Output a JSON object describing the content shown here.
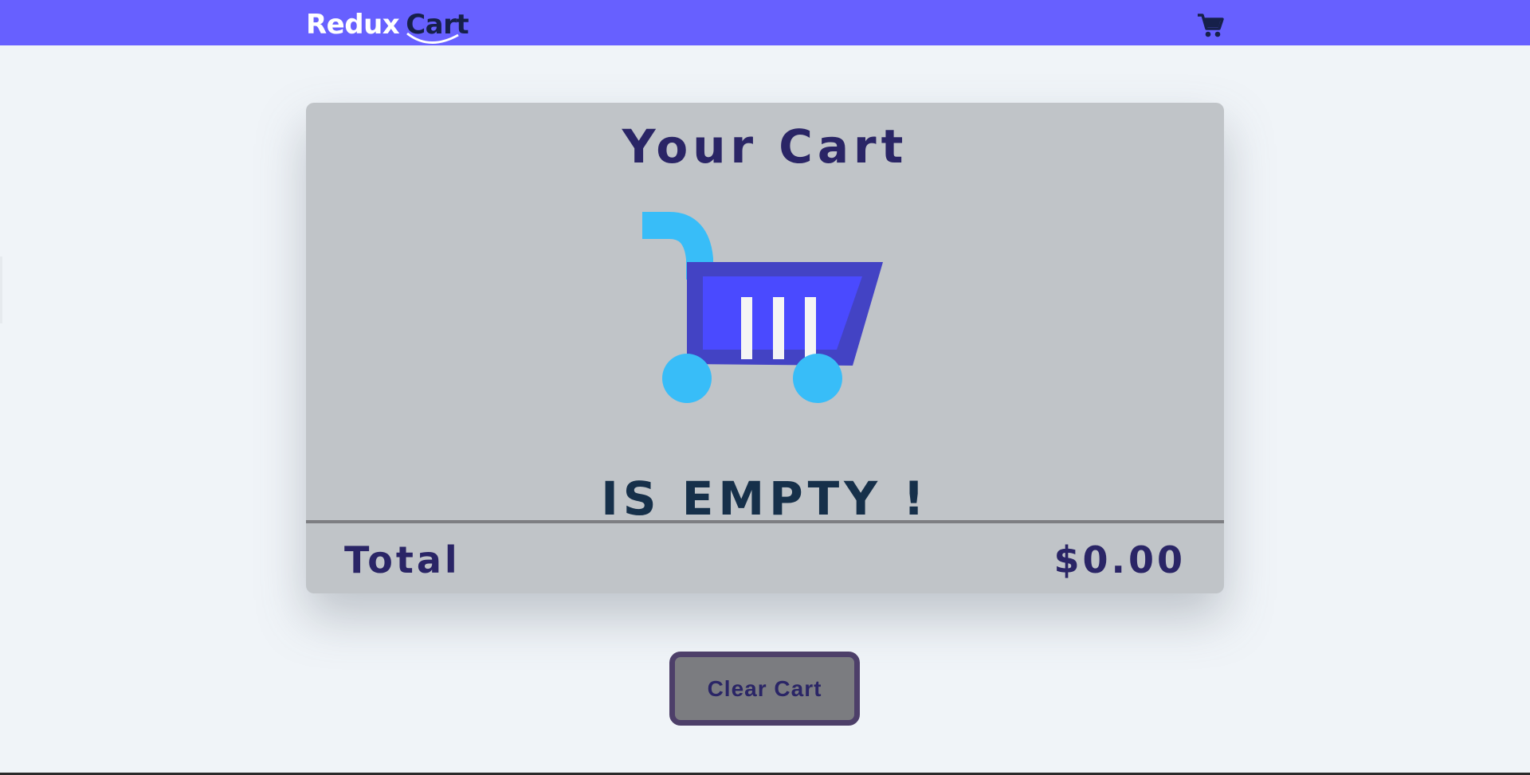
{
  "navbar": {
    "brand_part1": "Redux",
    "brand_part2": "Cart",
    "cart_icon": "shopping-cart-icon",
    "background": "#6760ff"
  },
  "cart": {
    "title": "Your Cart",
    "illustration": "empty-shopping-cart-illustration",
    "empty_message": "IS EMPTY !",
    "total_label": "Total",
    "total_value": "$0.00"
  },
  "actions": {
    "clear_label": "Clear Cart"
  },
  "colors": {
    "accent": "#6760ff",
    "title_text": "#2a2566",
    "card_bg": "#c0c4c8",
    "page_bg": "#f0f4f8"
  }
}
